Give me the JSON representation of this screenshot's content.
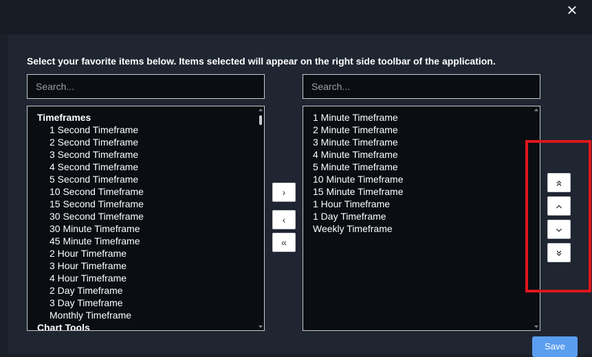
{
  "header": {
    "close_glyph": "✕"
  },
  "instructions": "Select your favorite items below. Items selected will appear on the right side toolbar of the application.",
  "left_panel": {
    "search_placeholder": "Search...",
    "groups": [
      {
        "label": "Timeframes",
        "items": [
          "1 Second Timeframe",
          "2 Second Timeframe",
          "3 Second Timeframe",
          "4 Second Timeframe",
          "5 Second Timeframe",
          "10 Second Timeframe",
          "15 Second Timeframe",
          "30 Second Timeframe",
          "30 Minute Timeframe",
          "45 Minute Timeframe",
          "2 Hour Timeframe",
          "3 Hour Timeframe",
          "4 Hour Timeframe",
          "2 Day Timeframe",
          "3 Day Timeframe",
          "Monthly Timeframe"
        ]
      },
      {
        "label": "Chart Tools",
        "items": []
      }
    ]
  },
  "right_panel": {
    "search_placeholder": "Search...",
    "items": [
      "1 Minute Timeframe",
      "2 Minute Timeframe",
      "3 Minute Timeframe",
      "4 Minute Timeframe",
      "5 Minute Timeframe",
      "10 Minute Timeframe",
      "15 Minute Timeframe",
      "1 Hour Timeframe",
      "1 Day Timeframe",
      "Weekly Timeframe"
    ]
  },
  "transfer_buttons": {
    "add": "›",
    "remove": "‹",
    "remove_all": "«"
  },
  "order_buttons": {
    "move_top_icon": "double-chevron-up-icon",
    "move_up_icon": "chevron-up-icon",
    "move_down_icon": "chevron-down-icon",
    "move_bottom_icon": "double-chevron-down-icon"
  },
  "colors": {
    "highlight": "#e0161c",
    "save_button": "#5b9ef0"
  },
  "save_label": "Save"
}
